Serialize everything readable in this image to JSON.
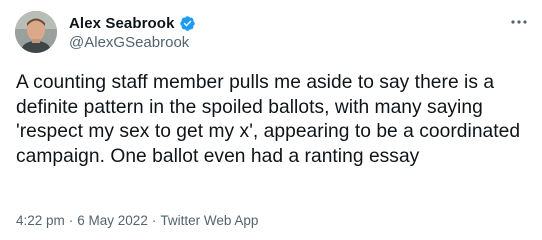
{
  "author": {
    "display_name": "Alex Seabrook",
    "handle": "@AlexGSeabrook",
    "verified": true,
    "verified_color": "#1d9bf0"
  },
  "icons": {
    "more": "more-horizontal-icon",
    "verified": "verified-badge-icon"
  },
  "tweet": {
    "text": "A counting staff member pulls me aside to say there is a definite pattern in the spoiled ballots, with many saying 'respect my sex to get my x', appearing to be a coordinated campaign. One ballot even had a ranting essay"
  },
  "meta": {
    "time": "4:22 pm",
    "date": "6 May 2022",
    "source": "Twitter Web App",
    "separator": "·"
  }
}
